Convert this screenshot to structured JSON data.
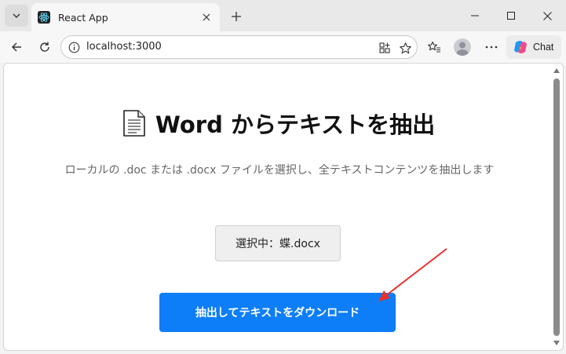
{
  "browser": {
    "tab_title": "React App",
    "url": "localhost:3000",
    "chat_label": "Chat",
    "new_tab_glyph": "+",
    "more_glyph": "···"
  },
  "page": {
    "title": "Word からテキストを抽出",
    "subtitle": "ローカルの .doc または .docx ファイルを選択し、全テキストコンテンツを抽出します",
    "file_button_label": "選択中：蝶.docx",
    "extract_button_label": "抽出してテキストをダウンロード"
  },
  "icons": {
    "tab_actions": "chevron-down-icon",
    "favicon": "react-logo-icon",
    "close": "close-icon",
    "back": "back-arrow-icon",
    "reload": "reload-icon",
    "site_info": "info-icon",
    "apps": "apps-icon",
    "favorite": "star-icon",
    "favorites_list": "favorites-icon",
    "doc": "document-icon",
    "copilot": "copilot-icon"
  },
  "colors": {
    "accent": "#0d7ef8",
    "annotation": "#e8312f"
  }
}
